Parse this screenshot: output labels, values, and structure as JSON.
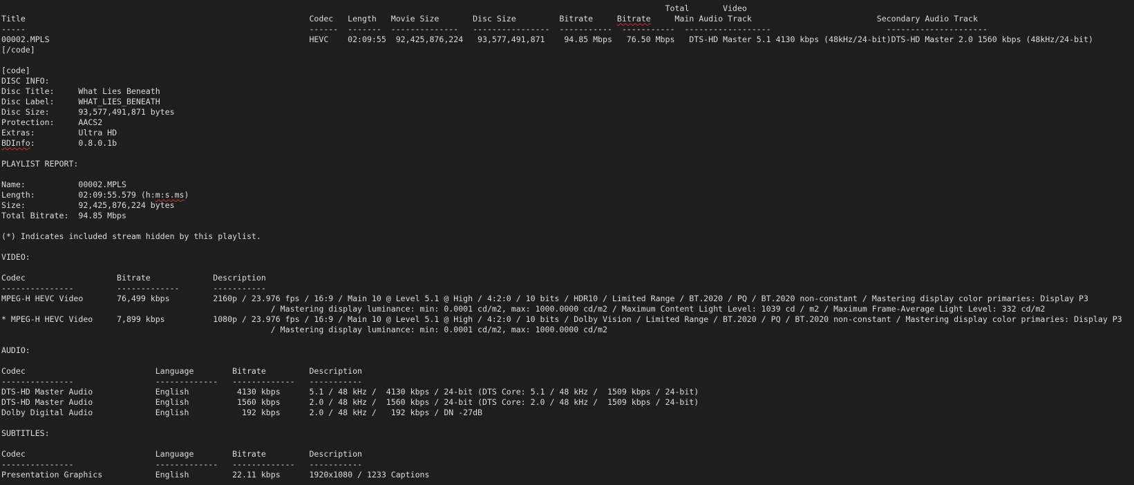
{
  "colors": {
    "background": "#1e1e1e",
    "text": "#dcdcdc",
    "spellcheck_underline": "#d03030"
  },
  "lines": [
    [
      {
        "t": "                                                                                                                                          Total       Video"
      }
    ],
    [
      {
        "t": "Title                                                           Codec   Length   Movie Size       Disc Size         Bitrate     "
      },
      {
        "t": "Bitrate",
        "spell": true
      },
      {
        "t": "     Main Audio Track                          Secondary Audio Track"
      }
    ],
    [
      {
        "t": "-----                                                           ------  -------  --------------   ----------------  -----------  -----------  ------------------                        ---------------------"
      }
    ],
    [
      {
        "t": "00002.MPLS                                                      HEVC    02:09:55  92,425,876,224   93,577,491,871    94.85 Mbps   76.50 Mbps   DTS-HD Master 5.1 4130 kbps (48kHz/24-bit)DTS-HD Master 2.0 1560 kbps (48kHz/24-bit)"
      }
    ],
    [
      {
        "t": "[/code]"
      }
    ],
    [
      {
        "t": ""
      }
    ],
    [
      {
        "t": "[code]"
      }
    ],
    [
      {
        "t": "DISC INFO:"
      }
    ],
    [
      {
        "t": "Disc Title:     What Lies Beneath"
      }
    ],
    [
      {
        "t": "Disc Label:     WHAT_LIES_BENEATH"
      }
    ],
    [
      {
        "t": "Disc Size:      93,577,491,871 bytes"
      }
    ],
    [
      {
        "t": "Protection:     AACS2"
      }
    ],
    [
      {
        "t": "Extras:         Ultra HD"
      }
    ],
    [
      {
        "t": "BDInfo",
        "spell": true
      },
      {
        "t": ":         0.8.0.1b"
      }
    ],
    [
      {
        "t": ""
      }
    ],
    [
      {
        "t": "PLAYLIST REPORT:"
      }
    ],
    [
      {
        "t": ""
      }
    ],
    [
      {
        "t": "Name:           00002.MPLS"
      }
    ],
    [
      {
        "t": "Length:         02:09:55.579 (h:"
      },
      {
        "t": "m:s.ms",
        "spell": true
      },
      {
        "t": ")"
      }
    ],
    [
      {
        "t": "Size:           92,425,876,224 bytes"
      }
    ],
    [
      {
        "t": "Total Bitrate:  94.85 Mbps"
      }
    ],
    [
      {
        "t": ""
      }
    ],
    [
      {
        "t": "(*) Indicates included stream hidden by this playlist."
      }
    ],
    [
      {
        "t": ""
      }
    ],
    [
      {
        "t": "VIDEO:"
      }
    ],
    [
      {
        "t": ""
      }
    ],
    [
      {
        "t": "Codec                   Bitrate             Description"
      }
    ],
    [
      {
        "t": "---------------         -------------       -----------"
      }
    ],
    [
      {
        "t": "MPEG-H HEVC Video       76,499 kbps         2160p / 23.976 fps / 16:9 / Main 10 @ Level 5.1 @ High / 4:2:0 / 10 bits / HDR10 / Limited Range / BT.2020 / PQ / BT.2020 non-constant / Mastering display color primaries: Display P3"
      }
    ],
    [
      {
        "t": "                                                        / Mastering display luminance: min: 0.0001 cd/m2, max: 1000.0000 cd/m2 / Maximum Content Light Level: 1039 cd / m2 / Maximum Frame-Average Light Level: 332 cd/m2"
      }
    ],
    [
      {
        "t": "* MPEG-H HEVC Video     7,899 kbps          1080p / 23.976 fps / 16:9 / Main 10 @ Level 5.1 @ High / 4:2:0 / 10 bits / Dolby Vision / Limited Range / BT.2020 / PQ / BT.2020 non-constant / Mastering display color primaries: Display P3"
      }
    ],
    [
      {
        "t": "                                                        / Mastering display luminance: min: 0.0001 cd/m2, max: 1000.0000 cd/m2"
      }
    ],
    [
      {
        "t": ""
      }
    ],
    [
      {
        "t": "AUDIO:"
      }
    ],
    [
      {
        "t": ""
      }
    ],
    [
      {
        "t": "Codec                           Language        Bitrate         Description"
      }
    ],
    [
      {
        "t": "---------------                 -------------   -------------   -----------"
      }
    ],
    [
      {
        "t": "DTS-HD Master Audio             English          4130 kbps      5.1 / 48 kHz /  4130 kbps / 24-bit (DTS Core: 5.1 / 48 kHz /  1509 kbps / 24-bit)"
      }
    ],
    [
      {
        "t": "DTS-HD Master Audio             English          1560 kbps      2.0 / 48 kHz /  1560 kbps / 24-bit (DTS Core: 2.0 / 48 kHz /  1509 kbps / 24-bit)"
      }
    ],
    [
      {
        "t": "Dolby Digital Audio             English           192 kbps      2.0 / 48 kHz /   192 kbps / DN -27dB"
      }
    ],
    [
      {
        "t": ""
      }
    ],
    [
      {
        "t": "SUBTITLES:"
      }
    ],
    [
      {
        "t": ""
      }
    ],
    [
      {
        "t": "Codec                           Language        Bitrate         Description"
      }
    ],
    [
      {
        "t": "---------------                 -------------   -------------   -----------"
      }
    ],
    [
      {
        "t": "Presentation Graphics           English         22.11 kbps      1920x1080 / 1233 Captions"
      }
    ]
  ]
}
